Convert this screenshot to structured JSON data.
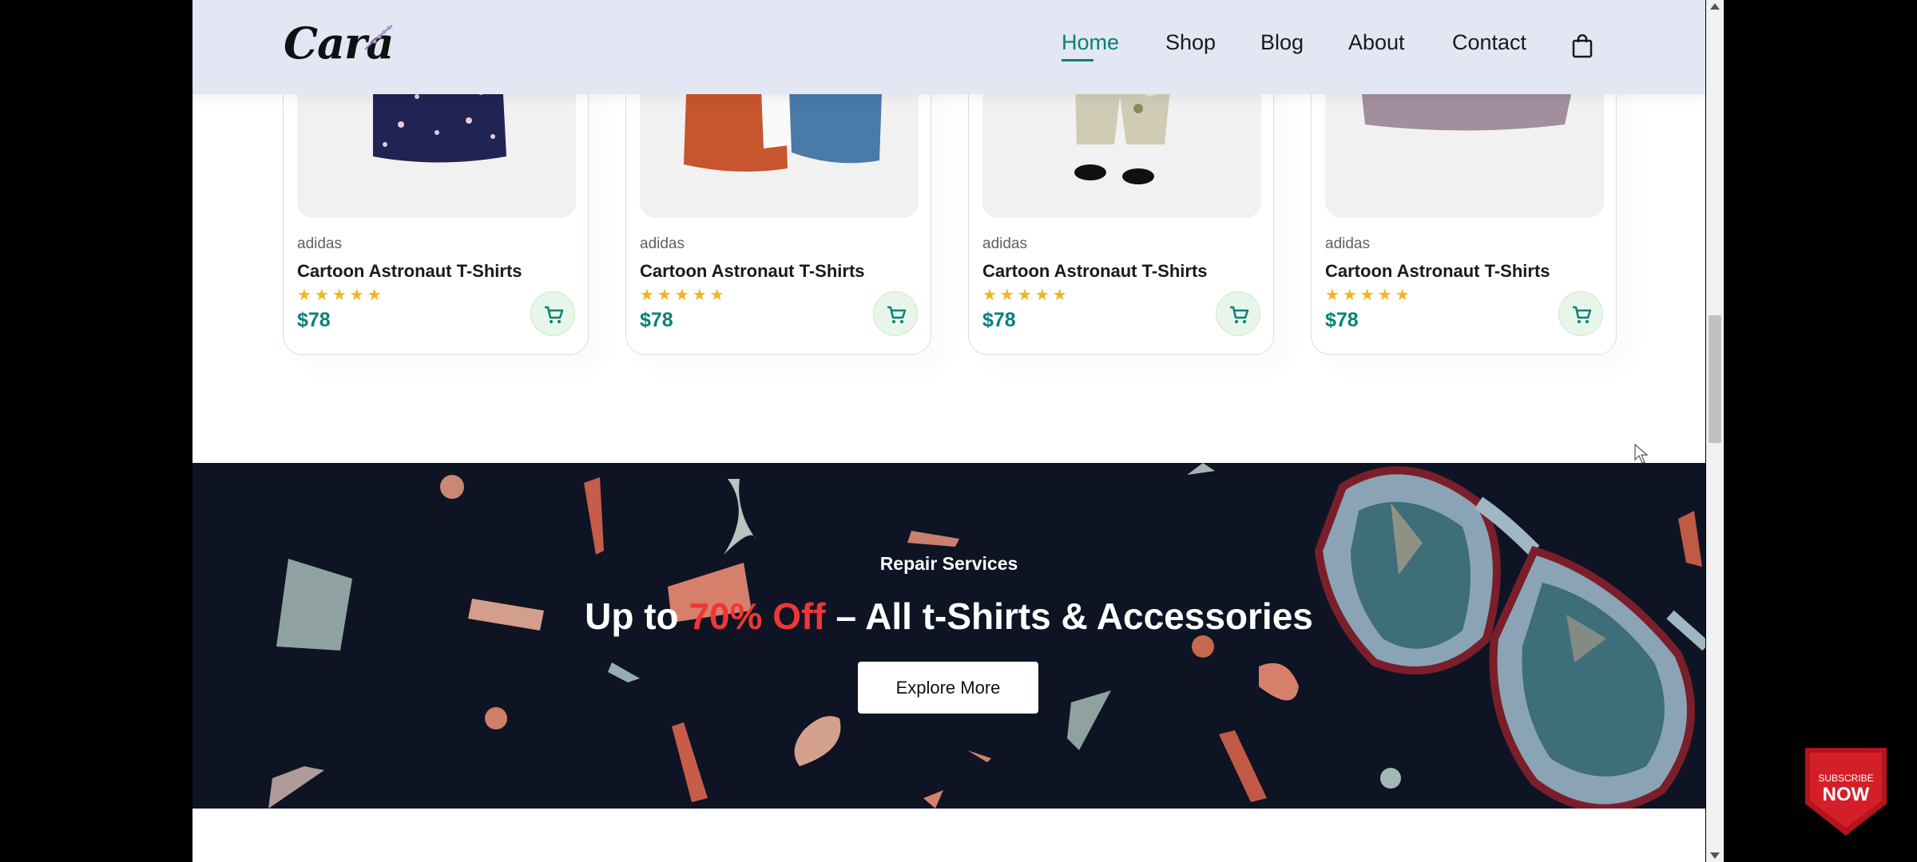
{
  "header": {
    "logo_text": "Cara",
    "nav": [
      {
        "label": "Home"
      },
      {
        "label": "Shop"
      },
      {
        "label": "Blog"
      },
      {
        "label": "About"
      },
      {
        "label": "Contact"
      }
    ],
    "active_nav": "Home",
    "cart_icon": "shopping-bag-icon"
  },
  "products": [
    {
      "brand": "adidas",
      "title": "Cartoon Astronaut T-Shirts",
      "rating": 5,
      "price": "$78",
      "image": "navy floral shirt"
    },
    {
      "brand": "adidas",
      "title": "Cartoon Astronaut T-Shirts",
      "rating": 5,
      "price": "$78",
      "image": "orange and blue shirts"
    },
    {
      "brand": "adidas",
      "title": "Cartoon Astronaut T-Shirts",
      "rating": 5,
      "price": "$78",
      "image": "trousers and shoes"
    },
    {
      "brand": "adidas",
      "title": "Cartoon Astronaut T-Shirts",
      "rating": 5,
      "price": "$78",
      "image": "mauve patterned shirt"
    }
  ],
  "stars_text": "★★★★★",
  "banner": {
    "tag": "Repair Services",
    "title_prefix": "Up to ",
    "title_highlight": "70% Off",
    "title_suffix": " – All t-Shirts & Accessories",
    "button_label": "Explore More"
  },
  "overlay": {
    "subscribe_line1": "SUBSCRIBE",
    "subscribe_line2": "NOW"
  },
  "colors": {
    "accent": "#088178",
    "header_bg": "#e3e6f3",
    "banner_bg": "#0e1424",
    "highlight": "#ef3636",
    "stars": "#f3b519"
  }
}
